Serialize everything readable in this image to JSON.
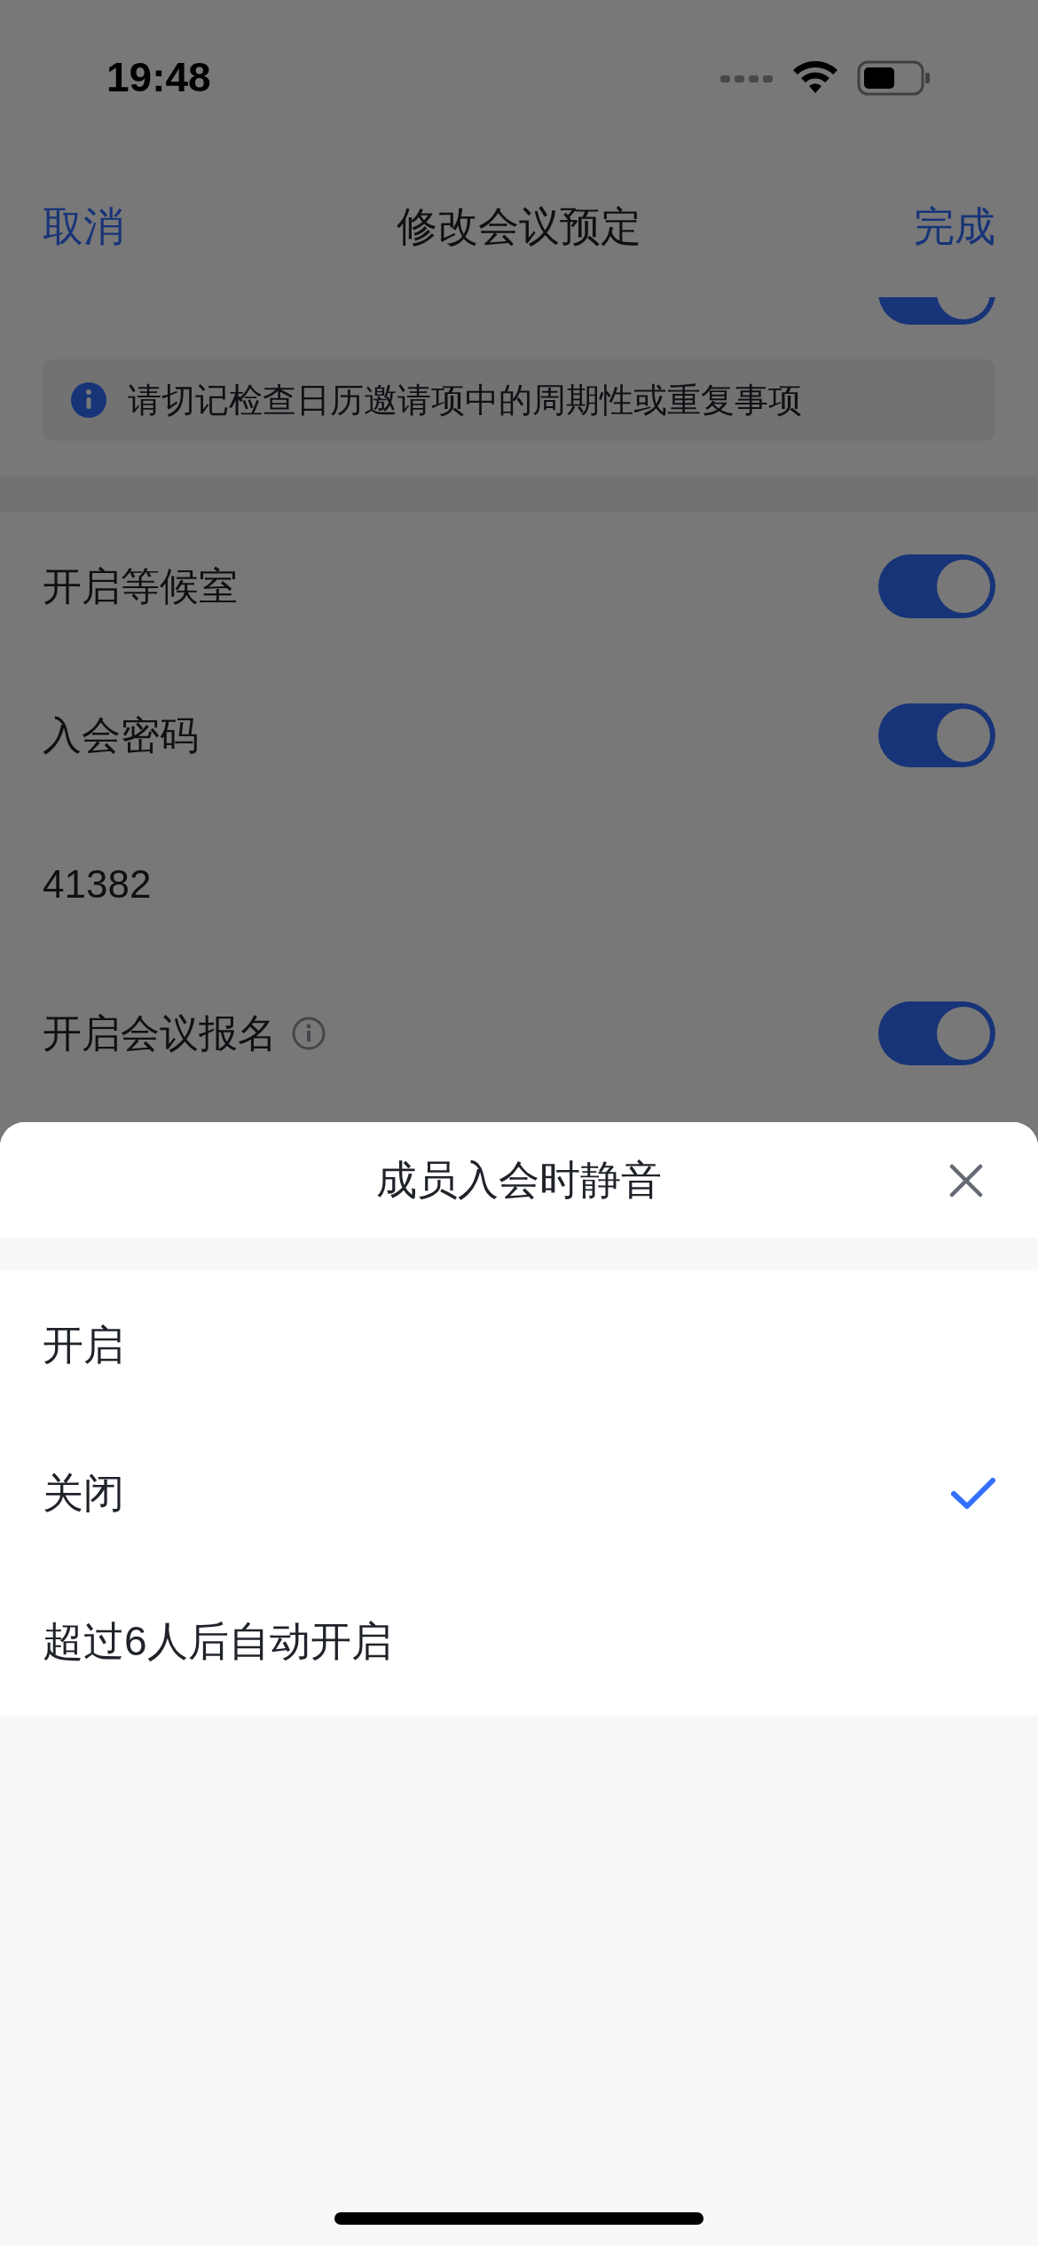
{
  "status_bar": {
    "time": "19:48"
  },
  "nav": {
    "cancel": "取消",
    "title": "修改会议预定",
    "done": "完成"
  },
  "calendar_row": {
    "on": true
  },
  "notice": "请切记检查日历邀请项中的周期性或重复事项",
  "settings": [
    {
      "kind": "toggle",
      "label": "开启等候室",
      "on": true,
      "info": false
    },
    {
      "kind": "toggle",
      "label": "入会密码",
      "on": true,
      "info": false
    },
    {
      "kind": "text",
      "label": "41382"
    },
    {
      "kind": "toggle",
      "label": "开启会议报名",
      "on": true,
      "info": true
    }
  ],
  "sheet": {
    "title": "成员入会时静音",
    "options": [
      {
        "label": "开启",
        "selected": false
      },
      {
        "label": "关闭",
        "selected": true
      },
      {
        "label": "超过6人后自动开启",
        "selected": false
      }
    ]
  }
}
